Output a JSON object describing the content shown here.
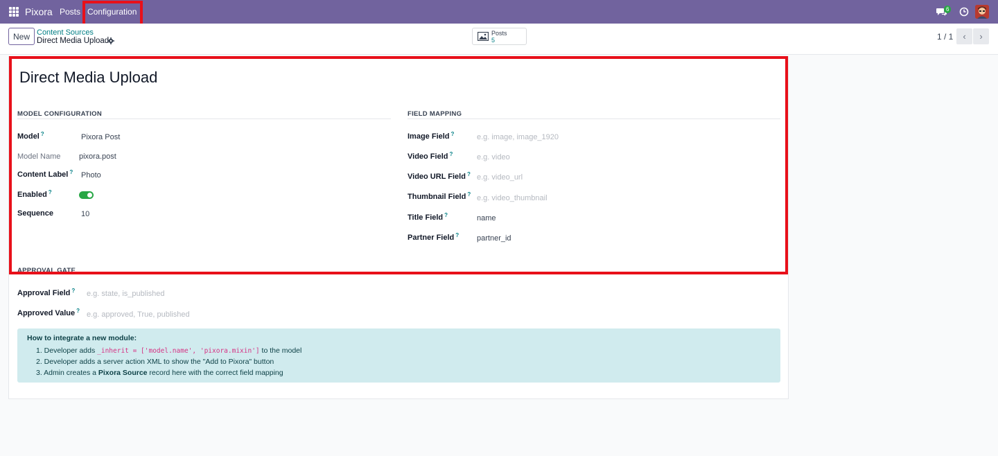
{
  "navbar": {
    "brand": "Pixora",
    "menu_posts": "Posts",
    "menu_configuration": "Configuration",
    "chat_badge": "6"
  },
  "control_panel": {
    "new_button": "New",
    "breadcrumb_parent": "Content Sources",
    "breadcrumb_current": "Direct Media Upload",
    "smart_button_label": "Posts",
    "smart_button_count": "5",
    "pager": "1 / 1"
  },
  "form": {
    "title": "Direct Media Upload",
    "model_config": {
      "heading": "MODEL CONFIGURATION",
      "model_label": "Model",
      "model_value": "Pixora Post",
      "model_name_label": "Model Name",
      "model_name_value": "pixora.post",
      "content_label_label": "Content Label",
      "content_label_value": "Photo",
      "enabled_label": "Enabled",
      "enabled": true,
      "sequence_label": "Sequence",
      "sequence_value": "10"
    },
    "field_mapping": {
      "heading": "FIELD MAPPING",
      "image_field_label": "Image Field",
      "image_field_placeholder": "e.g. image, image_1920",
      "video_field_label": "Video Field",
      "video_field_placeholder": "e.g. video",
      "video_url_field_label": "Video URL Field",
      "video_url_field_placeholder": "e.g. video_url",
      "thumbnail_field_label": "Thumbnail Field",
      "thumbnail_field_placeholder": "e.g. video_thumbnail",
      "title_field_label": "Title Field",
      "title_field_value": "name",
      "partner_field_label": "Partner Field",
      "partner_field_value": "partner_id"
    },
    "approval_gate": {
      "heading": "APPROVAL GATE",
      "approval_field_label": "Approval Field",
      "approval_field_placeholder": "e.g. state, is_published",
      "approved_value_label": "Approved Value",
      "approved_value_placeholder": "e.g. approved, True, published"
    },
    "info": {
      "title": "How to integrate a new module:",
      "step1_prefix": "1. Developer adds ",
      "step1_code": "_inherit = ['model.name', 'pixora.mixin']",
      "step1_suffix": " to the model",
      "step2": "2. Developer adds a server action XML to show the \"Add to Pixora\" button",
      "step3_prefix": "3. Admin creates a ",
      "step3_bold": "Pixora Source",
      "step3_suffix": " record here with the correct field mapping"
    }
  },
  "colors": {
    "navbar": "#71639e",
    "accent": "#017e84",
    "highlight": "#e8101a",
    "toggle_on": "#28a745",
    "info_bg": "#d0ebee"
  }
}
